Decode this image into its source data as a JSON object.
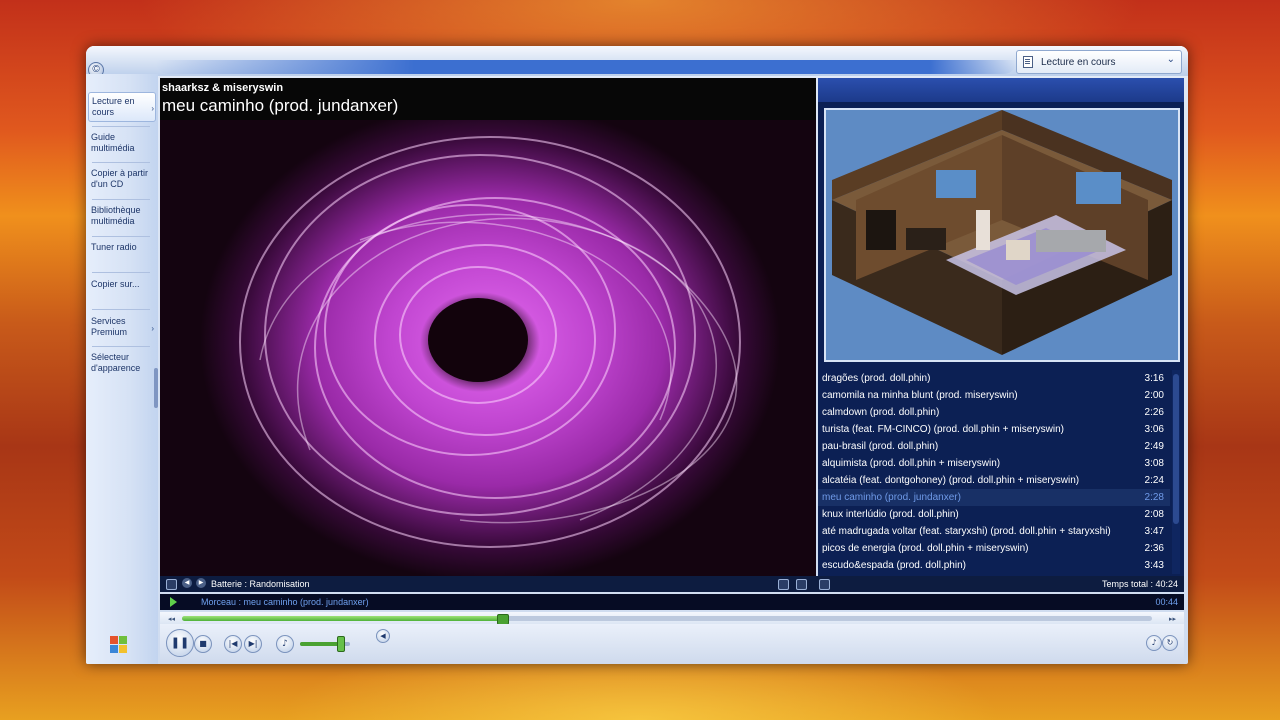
{
  "window": {
    "now_playing_menu": "Lecture en cours"
  },
  "sidebar": {
    "items": [
      {
        "label": "Lecture en cours",
        "active": true,
        "has_arrow": true
      },
      {
        "label": "Guide multimédia"
      },
      {
        "label": "Copier à partir d'un CD"
      },
      {
        "label": "Bibliothèque multimédia"
      },
      {
        "label": "Tuner radio"
      },
      {
        "label": "Copier sur..."
      },
      {
        "label": "Services Premium",
        "has_arrow": true
      },
      {
        "label": "Sélecteur d'apparence"
      }
    ]
  },
  "video": {
    "artist": "shaarksz & miseryswin",
    "title": "meu caminho (prod. jundanxer)"
  },
  "playlist": {
    "items": [
      {
        "title": "dragões (prod. doll.phin)",
        "duration": "3:16"
      },
      {
        "title": "camomila na minha blunt (prod. miseryswin)",
        "duration": "2:00"
      },
      {
        "title": "calmdown (prod. doll.phin)",
        "duration": "2:26"
      },
      {
        "title": "turista (feat. FM-CINCO) (prod. doll.phin + miseryswin)",
        "duration": "3:06"
      },
      {
        "title": "pau-brasil (prod. doll.phin)",
        "duration": "2:49"
      },
      {
        "title": "alquimista (prod. doll.phin + miseryswin)",
        "duration": "3:08"
      },
      {
        "title": "alcatéia (feat. dontgohoney) (prod. doll.phin + miseryswin)",
        "duration": "2:24"
      },
      {
        "title": "meu caminho (prod. jundanxer)",
        "duration": "2:28",
        "current": true
      },
      {
        "title": "knux interlúdio (prod. doll.phin)",
        "duration": "2:08"
      },
      {
        "title": "até madrugada voltar (feat. staryxshi) (prod. doll.phin + staryxshi)",
        "duration": "3:47"
      },
      {
        "title": "picos de energia (prod. doll.phin + miseryswin)",
        "duration": "2:36"
      },
      {
        "title": "escudo&espada (prod. doll.phin)",
        "duration": "3:43"
      }
    ],
    "total_label": "Temps total : 40:24"
  },
  "info_bar": {
    "visualization": "Batterie : Randomisation"
  },
  "status": {
    "track_label": "Morceau : meu caminho (prod. jundanxer)",
    "elapsed": "00:44"
  },
  "seek": {
    "progress": 0.33
  },
  "volume": {
    "level": 0.8
  },
  "colors": {
    "accent_green": "#4fb238",
    "playlist_bg": "#0c2054",
    "current_track": "#6f9ae8"
  },
  "icons": {
    "app_menu": "circle-c-icon",
    "playlist_doc": "document-icon",
    "windows_logo": "windows-flag-icon"
  }
}
